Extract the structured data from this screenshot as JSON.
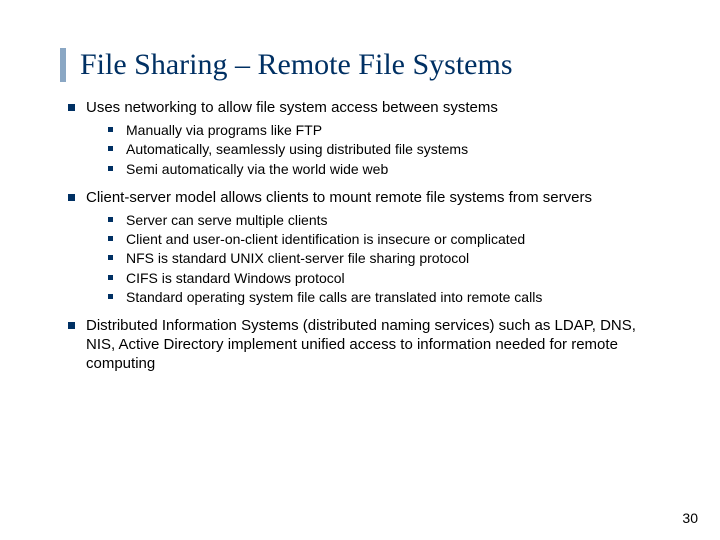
{
  "title": "File Sharing – Remote File Systems",
  "page_number": "30",
  "bullets": [
    {
      "text": "Uses networking to allow file system access between systems",
      "sub": [
        "Manually via programs like FTP",
        "Automatically, seamlessly using distributed file systems",
        "Semi automatically via the world wide web"
      ]
    },
    {
      "text": "Client-server model allows clients to mount remote file systems from servers",
      "sub": [
        "Server can serve multiple clients",
        "Client and user-on-client identification is insecure or complicated",
        "NFS is standard UNIX client-server file sharing protocol",
        "CIFS is standard Windows protocol",
        "Standard operating system file calls are translated into remote calls"
      ]
    },
    {
      "text": "Distributed Information Systems (distributed naming services) such as LDAP, DNS, NIS, Active Directory implement unified access to information needed for remote computing",
      "sub": []
    }
  ]
}
